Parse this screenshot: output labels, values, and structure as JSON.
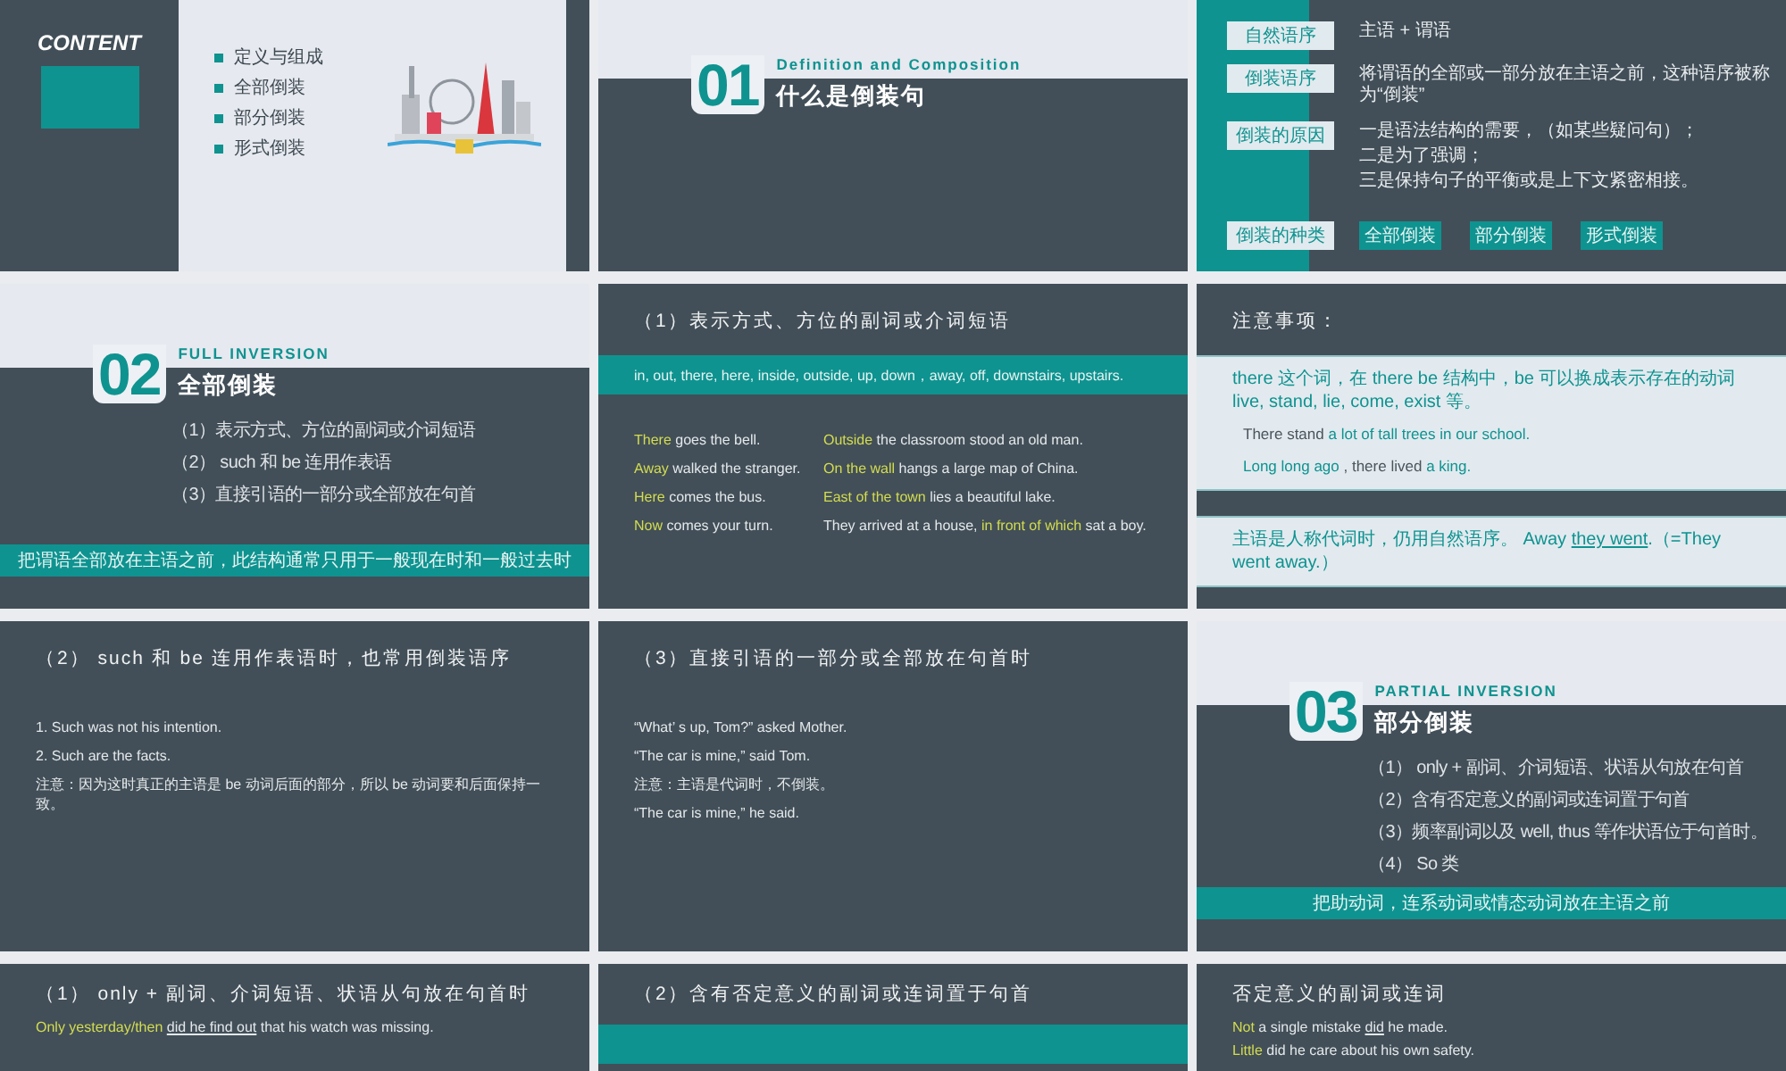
{
  "slides": [
    {
      "kind": "contents",
      "heading": "CONTENT",
      "items": [
        "定义与组成",
        "全部倒装",
        "部分倒装",
        "形式倒装"
      ]
    },
    {
      "kind": "section",
      "number": "01",
      "subtitle": "Definition and Composition",
      "title": "什么是倒装句"
    },
    {
      "kind": "definitions",
      "rows": [
        {
          "label": "自然语序",
          "kind": "text",
          "lines": [
            "主语 + 谓语"
          ]
        },
        {
          "label": "倒装语序",
          "kind": "text",
          "lines": [
            "将谓语的全部或一部分放在主语之前，这种语序被称为“倒装”"
          ]
        },
        {
          "label": "倒装的原因",
          "kind": "text",
          "lines": [
            "一是语法结构的需要，（如某些疑问句）；",
            "二是为了强调；",
            "三是保持句子的平衡或是上下文紧密相接。"
          ]
        },
        {
          "label": "倒装的种类",
          "kind": "tags",
          "tags": [
            "全部倒装",
            "部分倒装",
            "形式倒装"
          ]
        }
      ]
    },
    {
      "kind": "section",
      "number": "02",
      "subtitle": "FULL INVERSION",
      "title": "全部倒装",
      "items": [
        "（1）表示方式、方位的副词或介词短语",
        "（2） such 和 be 连用作表语",
        "（3）直接引语的一部分或全部放在句首"
      ],
      "band": "把谓语全部放在主语之前，此结构通常只用于一般现在时和一般过去时"
    },
    {
      "kind": "examples",
      "title": "（1）表示方式、方位的副词或介词短语",
      "band": "in, out, there, here, inside, outside, up, down，away, off, downstairs, upstairs.",
      "columns": [
        [
          "**There** goes the bell.",
          "**Away** walked the stranger.",
          "**Here** comes the bus.",
          "**Now** comes your turn."
        ],
        [
          "**Outside** the classroom stood an old man.",
          "**On the wall** hangs a large map of China.",
          "**East of the town** lies a beautiful lake.",
          "They arrived at a house, **in front of which** sat a boy."
        ]
      ]
    },
    {
      "kind": "notes",
      "title": "注意事项：",
      "boxes": [
        [
          "there 这个词，在 there be 结构中，be 可以换成表示存在的动词 live, stand, lie, come, exist 等。",
          "**There stand** a lot of tall trees in our school.",
          "Long long ago **, there lived** a king."
        ],
        [
          "主语是人称代词时，仍用自然语序。 Away *they went*.（=They went away.）"
        ]
      ]
    },
    {
      "kind": "examples",
      "title": "（2） such 和 be 连用作表语时，也常用倒装语序",
      "columns": [
        [
          "1. Such was not his intention.",
          "2. Such are the facts.",
          "注意：因为这时真正的主语是 be 动词后面的部分，所以 be 动词要和后面保持一致。"
        ]
      ]
    },
    {
      "kind": "examples",
      "title": "（3）直接引语的一部分或全部放在句首时",
      "columns": [
        [
          "“What’ s up, Tom?” asked Mother.",
          "“The car is mine,” said Tom.",
          "注意：主语是代词时，不倒装。",
          "“The car is mine,” he said."
        ]
      ]
    },
    {
      "kind": "section",
      "number": "03",
      "subtitle": "PARTIAL INVERSION",
      "title": "部分倒装",
      "items": [
        "（1） only + 副词、介词短语、状语从句放在句首",
        "（2）含有否定意义的副词或连词置于句首",
        "（3）频率副词以及 well, thus 等作状语位于句首时。",
        "（4） So 类"
      ],
      "band": "把助动词，连系动词或情态动词放在主语之前"
    },
    {
      "kind": "examples",
      "title": "（1） only + 副词、介词短语、状语从句放在句首时",
      "columns": [
        [
          "**Only yesterday/then** *did he find out* that his watch was missing."
        ]
      ]
    },
    {
      "kind": "examples",
      "title": "（2）含有否定意义的副词或连词置于句首",
      "band_visible": true
    },
    {
      "kind": "examples",
      "title": "否定意义的副词或连词",
      "columns": [
        [
          "**Not** a single mistake *did* he made.",
          "**Little** did he care about his own safety."
        ]
      ]
    }
  ]
}
